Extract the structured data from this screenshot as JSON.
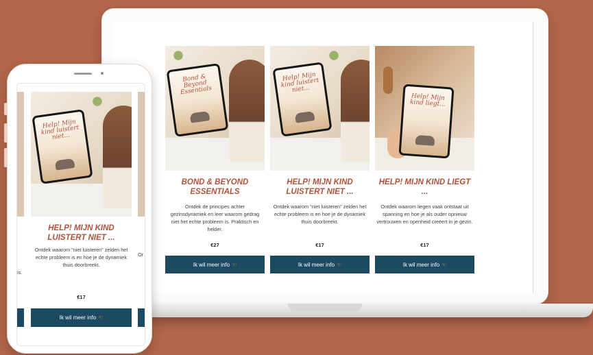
{
  "colors": {
    "background": "#b3664b",
    "accent_title": "#b0523a",
    "button": "#1d4a63",
    "button_text": "#ffffff"
  },
  "desktop": {
    "cards": [
      {
        "title": "BOND & BEYOND ESSENTIALS",
        "tablet_title": "Bond & Beyond Essentials",
        "description": "Ontdek de principes achter gezinsdynamiek en leer waarom gedrag niet het echte probleem is. Praktisch en helder.",
        "price": "€27",
        "button": "Ik wil meer info",
        "button_icon": "pointing-hand-icon"
      },
      {
        "title": "HELP! MIJN KIND LUISTERT NIET ...",
        "tablet_title": "Help! Mijn kind luistert niet...",
        "description": "Ontdek waarom \"niet luisteren\" zelden het echte probleem is en hoe je de dynamiek thuis doorbreekt.",
        "price": "€17",
        "button": "Ik wil meer info",
        "button_icon": "pointing-hand-icon"
      },
      {
        "title": "HELP! MIJN KIND LIEGT ...",
        "tablet_title": "Help! Mijn kind liegt...",
        "description": "Ontdek waarom liegen vaak ontstaat uit spanning en hoe je als ouder opnieuw vertrouwen en openheid creëert in je gezin.",
        "price": "€17",
        "button": "Ik wil meer info",
        "button_icon": "pointing-hand-icon"
      }
    ]
  },
  "mobile": {
    "card": {
      "title": "HELP! MIJN KIND LUISTERT NIET ...",
      "tablet_title": "Help! Mijn kind luistert niet...",
      "description": "Ontdek waarom \"niet luisteren\" zelden het echte probleem is en hoe je de dynamiek thuis doorbreekt.",
      "price": "€17",
      "button": "Ik wil meer info",
      "button_icon": "pointing-hand-icon"
    },
    "peek_left_text": "is.",
    "peek_right_text": "Or"
  }
}
